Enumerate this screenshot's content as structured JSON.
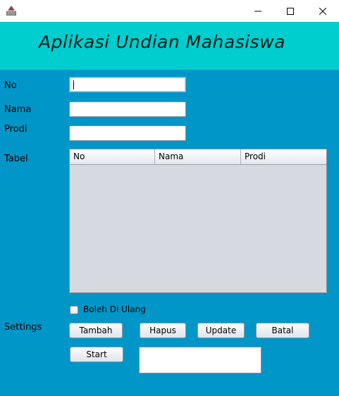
{
  "window": {
    "app_icon": "java-icon",
    "minimize_icon": "minimize-icon",
    "maximize_icon": "maximize-icon",
    "close_icon": "close-icon"
  },
  "header": {
    "title": "Aplikasi Undian Mahasiswa",
    "background": "#00cdcd"
  },
  "form": {
    "no_label": "No",
    "nama_label": "Nama",
    "prodi_label": "Prodi",
    "no_value": "",
    "nama_value": "",
    "prodi_value": "",
    "tabel_label": "Tabel",
    "settings_label": "Settings"
  },
  "table": {
    "columns": [
      "No",
      "Nama",
      "Prodi"
    ],
    "rows": []
  },
  "options": {
    "boleh_di_ulang_label": "Boleh Di Ulang",
    "boleh_di_ulang_checked": false
  },
  "buttons": {
    "tambah": "Tambah",
    "hapus": "Hapus",
    "update": "Update",
    "batal": "Batal",
    "start": "Start"
  },
  "output": {
    "value": ""
  },
  "colors": {
    "panel": "#0096c7",
    "header": "#00cdcd",
    "table_bg": "#d6d9e0"
  }
}
